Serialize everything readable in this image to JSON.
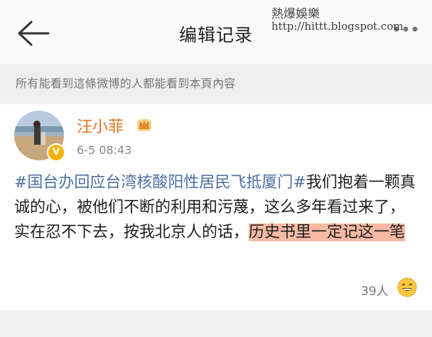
{
  "header": {
    "title": "编辑记录"
  },
  "watermark": {
    "line1": "熱爆娛樂",
    "line2": "http://hittt.blogspot.com"
  },
  "notice": {
    "text": "所有能看到這條微博的人都能看到本頁內容"
  },
  "post": {
    "username": "汪小菲",
    "timestamp": "6-5 08:43",
    "topic": "#国台办回应台湾核酸阳性居民飞抵厦门#",
    "body": "我们抱着一颗真诚的心，被他们不断的利用和污蔑，这么多年看过来了，实在忍不下去，按我北京人的话，",
    "highlight": "历史书里一定记这一笔",
    "likes": "39人"
  },
  "icons": [
    "back-arrow-icon",
    "more-dots-icon",
    "crown-icon",
    "verified-icon",
    "smile-emoji-icon"
  ],
  "colors": {
    "username": "#e8711f",
    "topic": "#4e6fa3",
    "highlight": "#f6b9a3",
    "verified": "#f4b400"
  }
}
